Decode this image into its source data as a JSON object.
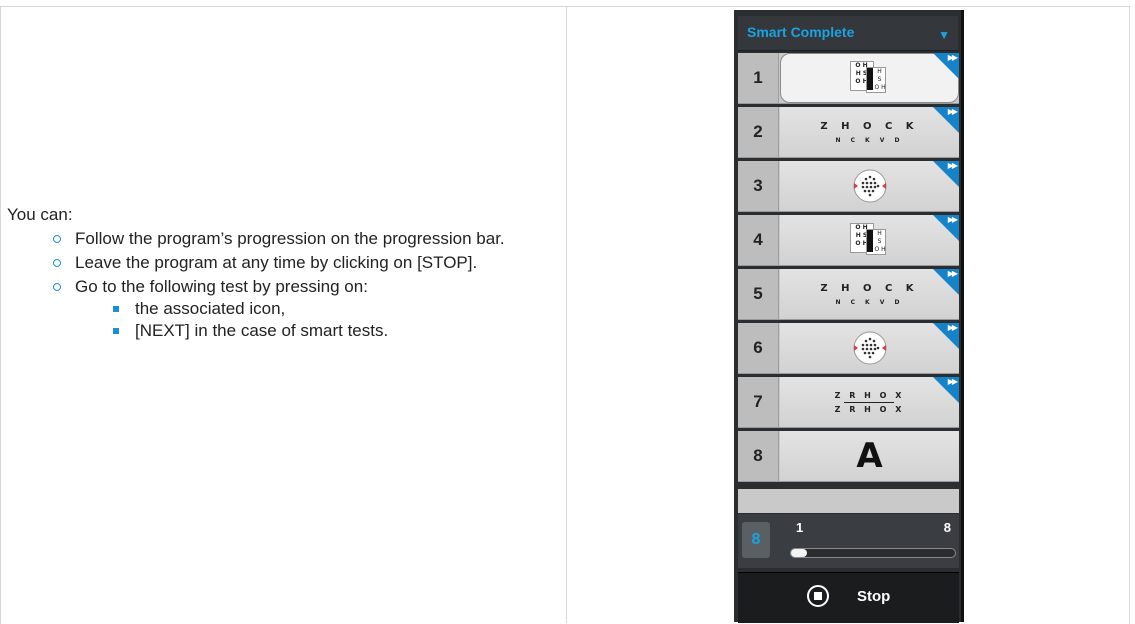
{
  "instructions": {
    "intro": "You can:",
    "items": [
      "Follow the program’s progression on the progression bar.",
      "Leave the program at any time by clicking on [STOP].",
      "Go to the following test by pressing on:"
    ],
    "subitems": [
      "the associated icon,",
      "[NEXT] in the case of smart tests."
    ]
  },
  "panel": {
    "program_title": "Smart Complete",
    "dropdown_icon": "triangle-down-icon",
    "rows": [
      {
        "number": "1",
        "test": "visual-acuity-chart",
        "chart_left": "O H\nH S\nO H",
        "chart_right": "H\nS\nO H"
      },
      {
        "number": "2",
        "test": "letter-line",
        "line1": "Z H O C K",
        "line2": "N C K V D"
      },
      {
        "number": "3",
        "test": "dot-target"
      },
      {
        "number": "4",
        "test": "visual-acuity-chart",
        "chart_left": "O H\nH S\nO H",
        "chart_right": "H\nS\nO H"
      },
      {
        "number": "5",
        "test": "letter-line",
        "line1": "Z H O C K",
        "line2": "N C K V D"
      },
      {
        "number": "6",
        "test": "dot-target"
      },
      {
        "number": "7",
        "test": "split-letters",
        "line1": "Z R H O X",
        "line2": "Z R H O X"
      },
      {
        "number": "8",
        "test": "big-letter",
        "letter": "A"
      }
    ],
    "next_icon": "fast-forward-icon",
    "progress": {
      "start": "1",
      "end": "8",
      "current_fraction": 0.1
    },
    "stop_label": "Stop",
    "accent": "#1aa3e0"
  }
}
